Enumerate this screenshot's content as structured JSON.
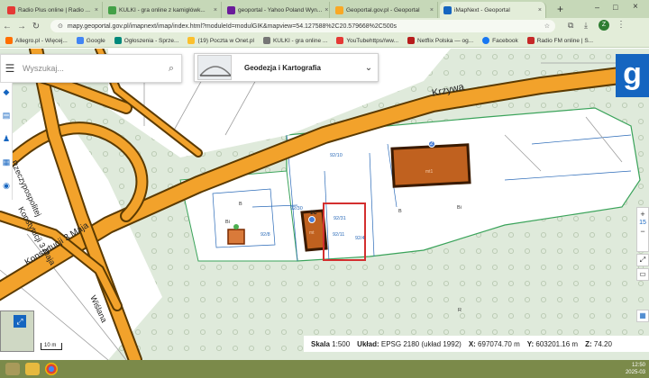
{
  "browser": {
    "tabs": [
      {
        "title": "Radio Plus online | Radio ...",
        "favicon_color": "#e53935",
        "active": false
      },
      {
        "title": "KULKI - gra online z kamigłówk...",
        "favicon_color": "#43a047",
        "active": false
      },
      {
        "title": "geoportal - Yahoo Poland Wyn...",
        "favicon_color": "#6a1b9a",
        "active": false
      },
      {
        "title": "Geoportal.gov.pl - Geoportal",
        "favicon_color": "#f9a825",
        "active": false
      },
      {
        "title": "iMapNext - Geoportal",
        "favicon_color": "#1565c0",
        "active": true
      }
    ],
    "new_tab_label": "+",
    "url": "mapy.geoportal.gov.pl/imapnext/imap/index.html?moduleId=modulGIK&mapview=54.127588%2C20.579668%2C500s",
    "profile_initial": "Z",
    "bookmarks": [
      {
        "label": "Allegro.pl - Więcej...",
        "color": "#ff6f00"
      },
      {
        "label": "Google",
        "color": "#4285f4"
      },
      {
        "label": "Ogłoszenia - Sprze...",
        "color": "#00897b"
      },
      {
        "label": "(19) Poczta w Onet.pl",
        "color": "#fbc02d"
      },
      {
        "label": "KULKI - gra online ...",
        "color": "#757575"
      },
      {
        "label": "YouTubehttps//ww...",
        "color": "#e53935"
      },
      {
        "label": "Netflix Polska — og...",
        "color": "#b71c1c"
      },
      {
        "label": "Facebook",
        "color": "#1877f2"
      },
      {
        "label": "Radio FM online | S...",
        "color": "#c62828"
      }
    ]
  },
  "app": {
    "search_placeholder": "Wyszukaj...",
    "layer_title": "Geodezja i Kartografia",
    "logo_letter": "g",
    "zoom_level": "15",
    "accent_color": "#1565c0"
  },
  "map": {
    "street_labels": [
      "Krzywa",
      "Konstytucji 3 Maja",
      "Konstytucji 3 Maja",
      "Wiślana",
      "Rzeczypospolitej"
    ],
    "parcel_labels": [
      "92/10",
      "92/31",
      "92/8",
      "92/30",
      "92/4",
      "92/11",
      "B",
      "Bi",
      "B",
      "Bi",
      "R"
    ],
    "building_numbers": [
      "2",
      "1C"
    ],
    "building_marks": [
      "mt1",
      "mt"
    ],
    "scale_label": "10 m"
  },
  "status": {
    "scale_label": "Skala",
    "scale_value": "1:500",
    "crs_label": "Układ:",
    "crs_value": "EPSG 2180 (układ 1992)",
    "x_label": "X:",
    "x_value": "697074.70 m",
    "y_label": "Y:",
    "y_value": "603201.16 m",
    "z_label": "Z:",
    "z_value": "74.20"
  },
  "taskbar": {
    "time": "12:50",
    "date": "2025-03"
  }
}
